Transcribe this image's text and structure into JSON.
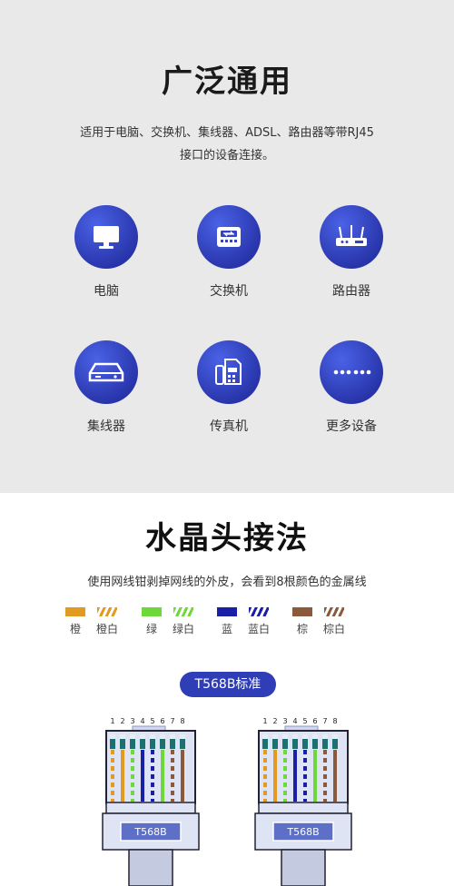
{
  "section1": {
    "title": "广泛通用",
    "desc_line1": "适用于电脑、交换机、集线器、ADSL、路由器等带RJ45",
    "desc_line2": "接口的设备连接。",
    "devices": [
      {
        "label": "电脑",
        "icon": "monitor-icon"
      },
      {
        "label": "交换机",
        "icon": "switch-icon"
      },
      {
        "label": "路由器",
        "icon": "router-icon"
      },
      {
        "label": "集线器",
        "icon": "hub-icon"
      },
      {
        "label": "传真机",
        "icon": "fax-icon"
      },
      {
        "label": "更多设备",
        "icon": "more-icon"
      }
    ]
  },
  "section2": {
    "title": "水晶头接法",
    "desc": "使用网线钳剥掉网线的外皮，会看到8根颜色的金属线",
    "wires": [
      {
        "label": "橙",
        "color": "#e29a22",
        "striped": false
      },
      {
        "label": "橙白",
        "color": "#e29a22",
        "striped": true
      },
      {
        "label": "绿",
        "color": "#6ed83a",
        "striped": false
      },
      {
        "label": "绿白",
        "color": "#6ed83a",
        "striped": true
      },
      {
        "label": "蓝",
        "color": "#1a1fa8",
        "striped": false
      },
      {
        "label": "蓝白",
        "color": "#1a1fa8",
        "striped": true
      },
      {
        "label": "棕",
        "color": "#8a5a3a",
        "striped": false
      },
      {
        "label": "棕白",
        "color": "#8a5a3a",
        "striped": true
      }
    ],
    "standard_button": "T568B标准",
    "pin_numbers": [
      "1",
      "2",
      "3",
      "4",
      "5",
      "6",
      "7",
      "8"
    ],
    "plug_label": "T568B"
  }
}
